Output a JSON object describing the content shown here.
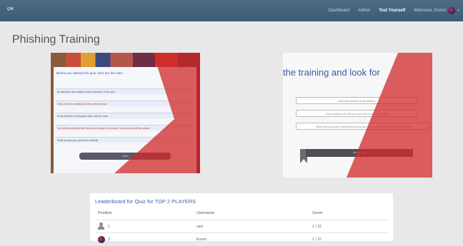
{
  "nav": {
    "brand": "QM",
    "links": [
      "Dashboard",
      "Admin",
      "Test Yourself"
    ],
    "active_index": 2,
    "welcome": "Welcome, Enzen"
  },
  "page_title": "Phishing Training",
  "card_left": {
    "heading": "Before you attempt the quiz, here are the rules",
    "rules": [
      "All questions are multiple choice questions in this quiz.",
      "Only one of the questions is the correct choice.",
      "Every Question is displayed only once per user.",
      "You will be presented with the correct answer or incorrect, once you submit the answer.",
      "Read through your questions carefully."
    ],
    "button": "Got it"
  },
  "card_right": {
    "heading": "the training and look for",
    "items": [
      "Check the sender's email address",
      "Look carefully at the list by hover over it, before clicking it",
      "Before giving out your information on any site, look for the padlock in the address bar"
    ],
    "button": "Got the Tips"
  },
  "leaderboard": {
    "title": "Leaderboard for Quiz for TOP 2 PLAYERS",
    "columns": [
      "Position",
      "Username",
      "Score"
    ],
    "rows": [
      {
        "position": "1",
        "username": "sam",
        "score": "1 / 10"
      },
      {
        "position": "2",
        "username": "Enzen",
        "score": "1 / 10"
      }
    ]
  }
}
